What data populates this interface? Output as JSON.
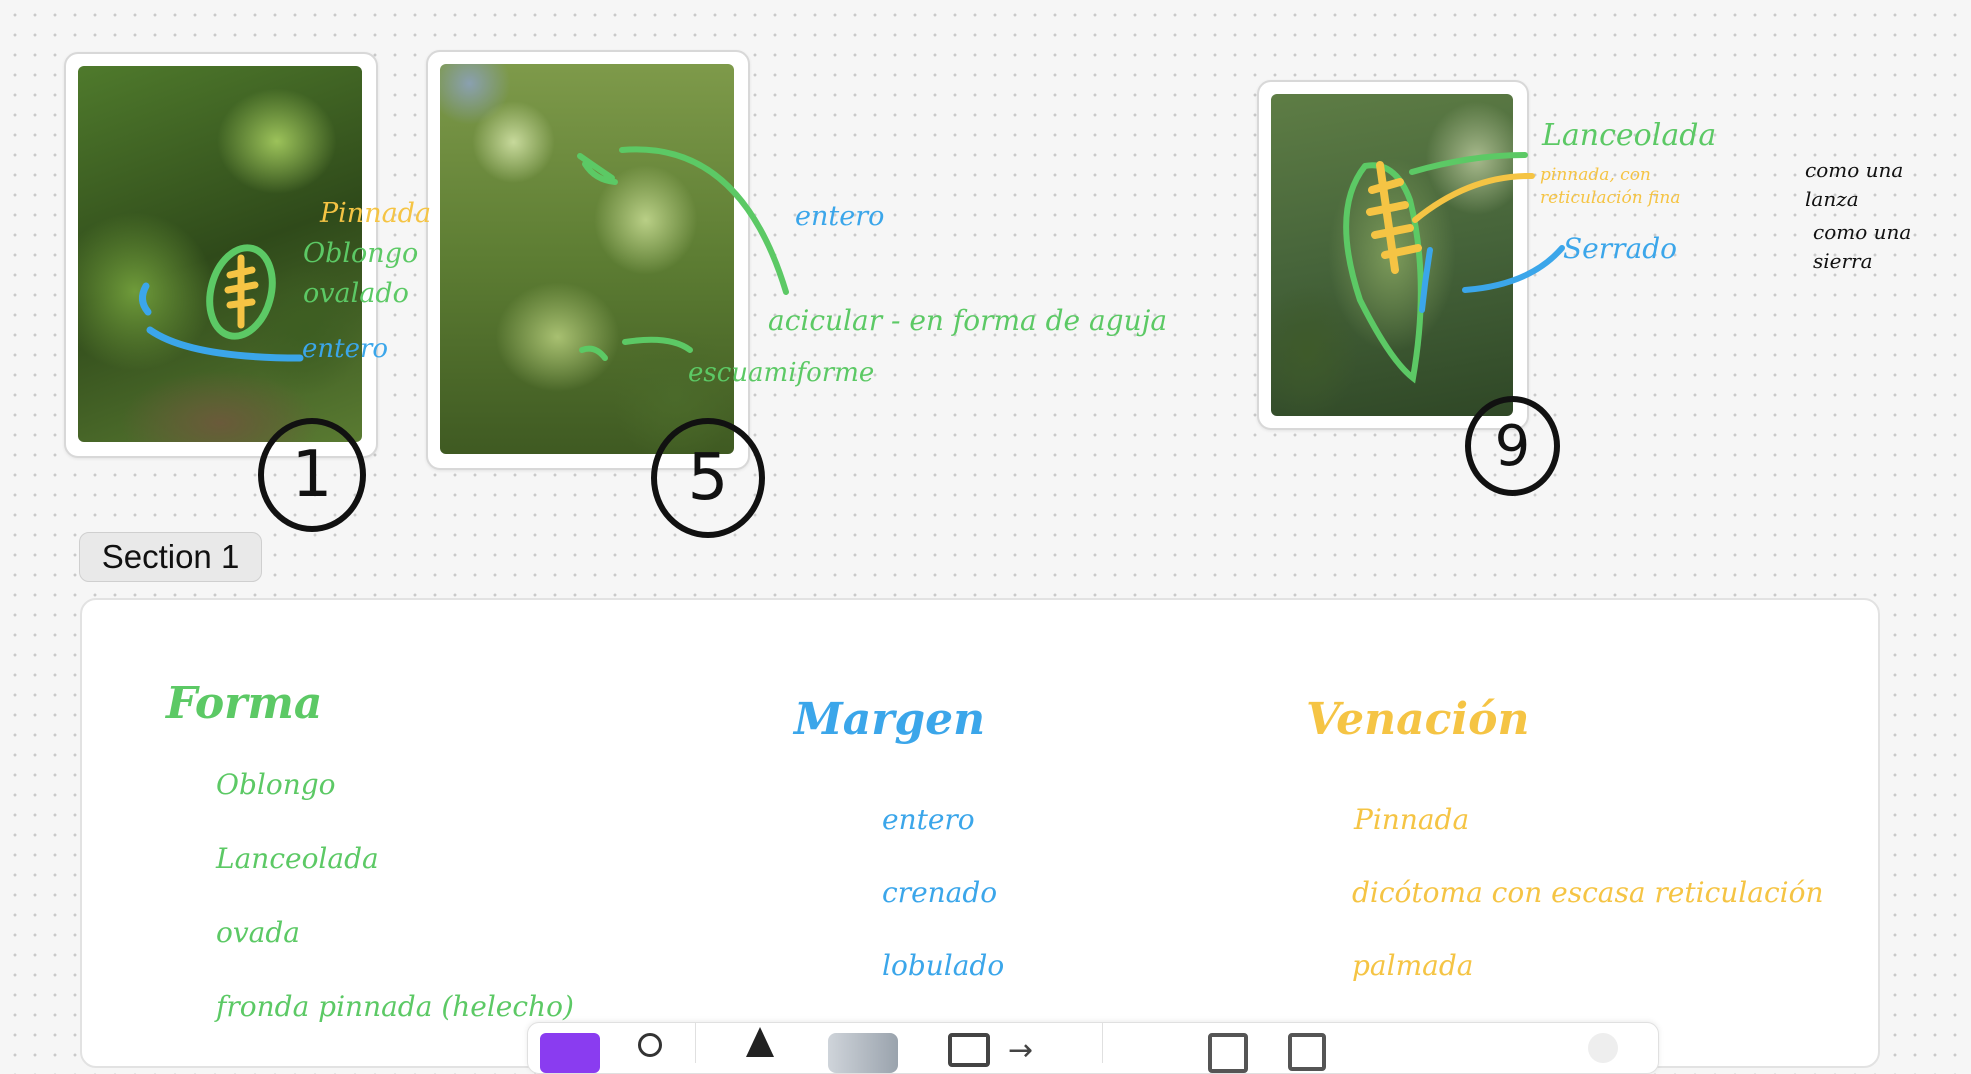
{
  "cards": [
    {
      "number": "1",
      "labels": {
        "venation": "Pinnada",
        "shape_1": "Oblongo",
        "shape_2": "ovalado",
        "margin": "entero"
      }
    },
    {
      "number": "5",
      "labels": {
        "margin": "entero",
        "shape_1": "acicular - en forma de aguja",
        "shape_2": "escuamiforme"
      }
    },
    {
      "number": "9",
      "labels": {
        "shape": "Lanceolada",
        "venation": "pinnada, con reticulación fina",
        "margin": "Serrado"
      }
    }
  ],
  "notes": {
    "note_1": "como una lanza",
    "note_2": "como una sierra"
  },
  "section": {
    "label": "Section 1",
    "columns": [
      {
        "heading": "Forma",
        "items": [
          "Oblongo",
          "Lanceolada",
          "ovada",
          "fronda pinnada (helecho)"
        ]
      },
      {
        "heading": "Margen",
        "items": [
          "entero",
          "crenado",
          "lobulado"
        ]
      },
      {
        "heading": "Venación",
        "items": [
          "Pinnada",
          "dicótoma con escasa reticulación",
          "palmada"
        ]
      }
    ]
  },
  "colors": {
    "shape": "#5cc965",
    "margin": "#3ba6ea",
    "venation": "#f5c444",
    "ink": "#111111",
    "tool_accent": "#8a3cf0"
  },
  "toolbar": {
    "tools": [
      "color-swatch-icon",
      "lasso-icon",
      "pen-icon",
      "eraser-icon",
      "shape-icon",
      "arrow-icon",
      "sticky-note-icon",
      "text-icon",
      "more-icon"
    ]
  }
}
